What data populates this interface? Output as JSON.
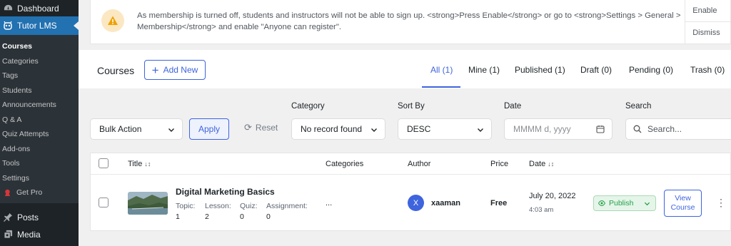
{
  "sidebar": {
    "dashboard_label": "Dashboard",
    "tutor_label": "Tutor LMS",
    "items": [
      {
        "label": "Courses",
        "active": true
      },
      {
        "label": "Categories"
      },
      {
        "label": "Tags"
      },
      {
        "label": "Students"
      },
      {
        "label": "Announcements"
      },
      {
        "label": "Q & A"
      },
      {
        "label": "Quiz Attempts"
      },
      {
        "label": "Add-ons"
      },
      {
        "label": "Tools"
      },
      {
        "label": "Settings"
      },
      {
        "label": "Get Pro"
      }
    ],
    "posts_label": "Posts",
    "media_label": "Media"
  },
  "notice": {
    "text": "As membership is turned off, students and instructors will not be able to sign up. <strong>Press Enable</strong> or go to <strong>Settings > General > Membership</strong> and enable \"Anyone can register\".",
    "enable_label": "Enable",
    "dismiss_label": "Dismiss"
  },
  "header": {
    "title": "Courses",
    "add_new_label": "Add New",
    "tabs": [
      {
        "label": "All (1)",
        "active": true
      },
      {
        "label": "Mine (1)"
      },
      {
        "label": "Published (1)"
      },
      {
        "label": "Draft (0)"
      },
      {
        "label": "Pending (0)"
      },
      {
        "label": "Trash (0)"
      }
    ]
  },
  "filters": {
    "bulk_action": "Bulk Action",
    "apply_label": "Apply",
    "reset_label": "Reset",
    "category_label": "Category",
    "category_value": "No record found",
    "sort_label": "Sort By",
    "sort_value": "DESC",
    "date_label": "Date",
    "date_placeholder": "MMMM d, yyyy",
    "search_label": "Search",
    "search_placeholder": "Search..."
  },
  "table": {
    "columns": {
      "title": "Title",
      "categories": "Categories",
      "author": "Author",
      "price": "Price",
      "date": "Date"
    },
    "rows": [
      {
        "title": "Digital Marketing Basics",
        "topic_label": "Topic:",
        "topic": "1",
        "lesson_label": "Lesson:",
        "lesson": "2",
        "quiz_label": "Quiz:",
        "quiz": "0",
        "assignment_label": "Assignment:",
        "assignment": "0",
        "categories": "...",
        "author_initial": "X",
        "author": "xaaman",
        "price": "Free",
        "date": "July 20, 2022",
        "time": "4:03 am",
        "status": "Publish",
        "view_label": "View Course"
      }
    ]
  },
  "colors": {
    "accent": "#3e64de",
    "wp_sidebar": "#1d2327",
    "wp_active": "#2271b1",
    "publish_green": "#24a148"
  }
}
